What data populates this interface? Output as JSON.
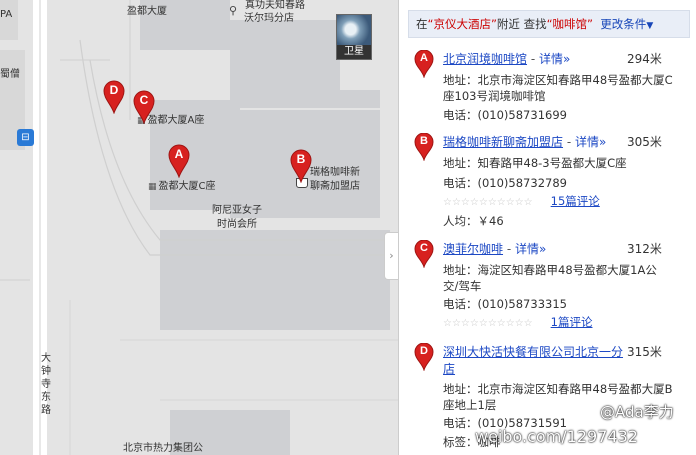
{
  "map": {
    "labels": {
      "top_left_p": "PA",
      "shengdu_top": "盈都大厦",
      "zhenggong": "真功夫知春路",
      "walmart": "沃尔玛分店",
      "left_partial": "蜀僧",
      "shengdu_a": "盈都大厦A座",
      "shengdu_c": "盈都大厦C座",
      "ruige_1": "瑞格咖啡新",
      "ruige_2": "聊斋加盟店",
      "anniya_1": "阿尼亚女子",
      "anniya_2": "时尚会所",
      "road_vertical": "大钟寺东路",
      "bottom_label": "北京市热力集团公"
    },
    "satellite_label": "卫星",
    "bus_icon": "bus-icon",
    "collapse_arrow": "›",
    "markers": [
      "D",
      "C",
      "A",
      "B"
    ]
  },
  "search": {
    "prefix": "在",
    "place": "“京仪大酒店”",
    "middle": "附近 查找",
    "keyword": "“咖啡馆”",
    "more": "更改条件",
    "caret": "▼"
  },
  "results": [
    {
      "letter": "A",
      "name": "北京润境咖啡馆",
      "sep": " - ",
      "detail": "详情»",
      "distance": "294米",
      "address_1": "地址：北京市海淀区知春路甲48号盈都大厦C",
      "address_2": "座103号润境咖啡馆",
      "phone": "电话：(010)58731699",
      "stars": "☆☆☆☆☆☆☆☆☆☆",
      "reviews": ""
    },
    {
      "letter": "B",
      "name": "瑞格咖啡新聊斋加盟店",
      "sep": " - ",
      "detail": "详情»",
      "distance": "305米",
      "address_1": "地址：知春路甲48-3号盈都大厦C座",
      "address_2": "",
      "phone": "电话：(010)58732789",
      "stars": "☆☆☆☆☆☆☆☆☆☆",
      "reviews": "15篇评论",
      "avg": "人均：￥46"
    },
    {
      "letter": "C",
      "name": "澳菲尔咖啡",
      "sep": " - ",
      "detail": "详情»",
      "distance": "312米",
      "address_1": "地址：海淀区知春路甲48号盈都大厦1A公",
      "address_2": "交/驾车",
      "phone": "电话：(010)58733315",
      "stars": "☆☆☆☆☆☆☆☆☆☆",
      "reviews": "1篇评论"
    },
    {
      "letter": "D",
      "name_1": "深圳大快活快餐有限公司北京一分",
      "name_2": "店",
      "distance": "315米",
      "address_1": "地址：北京市海淀区知春路甲48号盈都大厦B",
      "address_2": "座地上1层",
      "phone": "电话：(010)58731591",
      "tag": "标签：咖啡"
    }
  ],
  "watermark": {
    "line1": "@Ada李力",
    "line2": "weibo.com/1297432"
  },
  "colors": {
    "marker_red": "#d7211f",
    "link_blue": "#1c48c4",
    "map_bg": "#e4e4e4",
    "block_gray": "#cfd0d3"
  }
}
